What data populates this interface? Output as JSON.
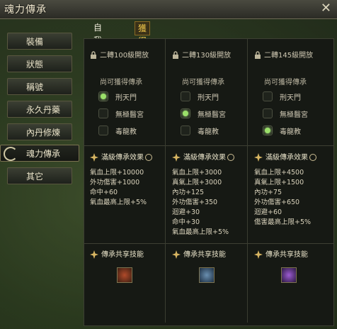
{
  "window": {
    "title": "魂力傳承",
    "close_glyph": "✕"
  },
  "sidebar": {
    "items": [
      {
        "label": "裝備",
        "active": false
      },
      {
        "label": "狀態",
        "active": false
      },
      {
        "label": "稱號",
        "active": false
      },
      {
        "label": "永久丹藥",
        "active": false
      },
      {
        "label": "內丹修煉",
        "active": false
      },
      {
        "label": "魂力傳承",
        "active": true
      },
      {
        "label": "其它",
        "active": false
      }
    ]
  },
  "tabs": [
    {
      "label": "自我修練",
      "active": false
    },
    {
      "label": "獲得傳承",
      "active": true
    }
  ],
  "columns": [
    {
      "unlock": "二轉100級開放",
      "section_label": "尚可獲得傳承",
      "options": [
        {
          "label": "刑天門",
          "selected": true
        },
        {
          "label": "無極醫宮",
          "selected": false
        },
        {
          "label": "毒龍教",
          "selected": false
        }
      ],
      "effects_title": "滿級傳承效果",
      "effects": [
        "氣血上限+10000",
        "外功傷害+1000",
        "命中+60",
        "氣血最高上限+5%"
      ],
      "skill_title": "傳承共享技能",
      "skill_icon": "warrior-skill-icon"
    },
    {
      "unlock": "二轉130級開放",
      "section_label": "尚可獲得傳承",
      "options": [
        {
          "label": "刑天門",
          "selected": false
        },
        {
          "label": "無極醫宮",
          "selected": true
        },
        {
          "label": "毒龍教",
          "selected": false
        }
      ],
      "effects_title": "滿級傳承效果",
      "effects": [
        "氣血上限+3000",
        "真氣上限+3000",
        "內功+125",
        "外功傷害+350",
        "迴避+30",
        "命中+30",
        "氣血最高上限+5%"
      ],
      "skill_title": "傳承共享技能",
      "skill_icon": "healer-skill-icon"
    },
    {
      "unlock": "二轉145級開放",
      "section_label": "尚可獲得傳承",
      "options": [
        {
          "label": "刑天門",
          "selected": false
        },
        {
          "label": "無極醫宮",
          "selected": false
        },
        {
          "label": "毒龍教",
          "selected": true
        }
      ],
      "effects_title": "滿級傳承效果",
      "effects": [
        "氣血上限+4500",
        "真氣上限+1500",
        "內功+75",
        "外功傷害+650",
        "迴避+60",
        "傷害最高上限+5%"
      ],
      "skill_title": "傳承共享技能",
      "skill_icon": "poison-skill-icon"
    }
  ],
  "colors": {
    "accent": "#f0c64a",
    "selected_dot": "#9be06a"
  }
}
